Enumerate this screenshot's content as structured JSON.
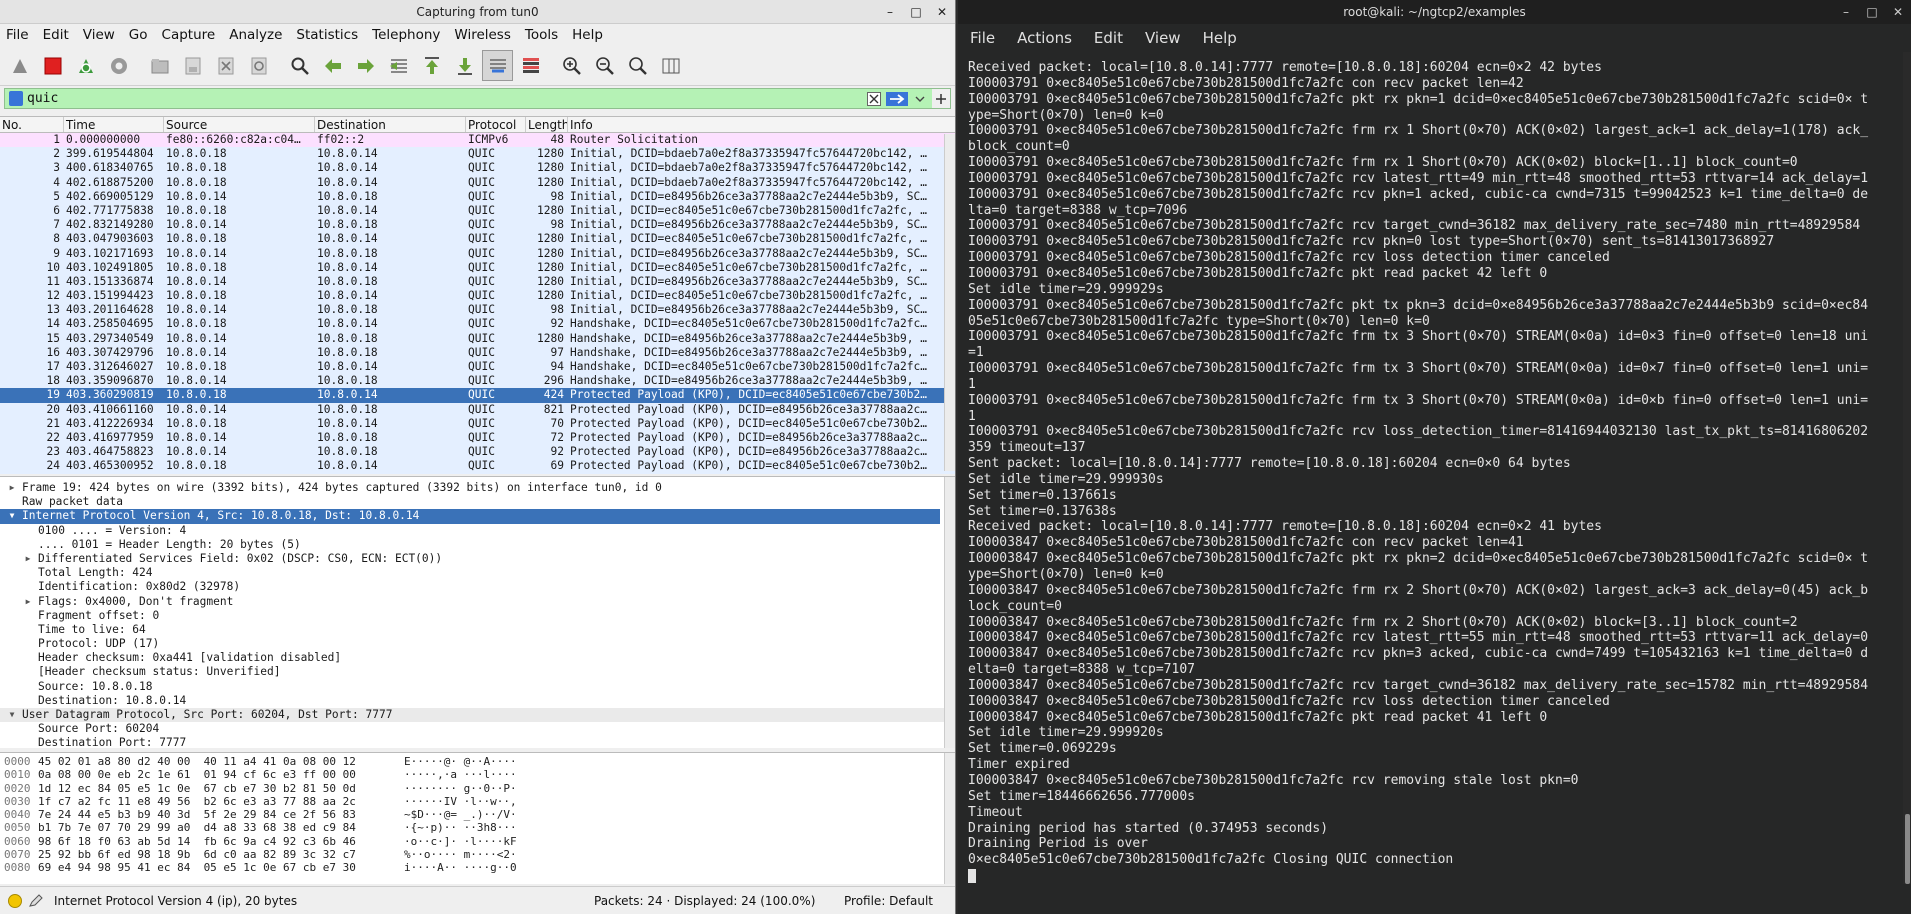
{
  "wireshark": {
    "window_title": "Capturing from tun0",
    "win_controls": [
      "–",
      "□",
      "✕"
    ],
    "menu": [
      "File",
      "Edit",
      "View",
      "Go",
      "Capture",
      "Analyze",
      "Statistics",
      "Telephony",
      "Wireless",
      "Tools",
      "Help"
    ],
    "filter_value": "quic",
    "columns": [
      "No.",
      "Time",
      "Source",
      "Destination",
      "Protocol",
      "Length",
      "Info"
    ],
    "packets": [
      {
        "no": "1",
        "time": "0.000000000",
        "src": "fe80::6260:c82a:c04…",
        "dst": "ff02::2",
        "proto": "ICMPv6",
        "len": "48",
        "info": "Router Solicitation"
      },
      {
        "no": "2",
        "time": "399.619544804",
        "src": "10.8.0.18",
        "dst": "10.8.0.14",
        "proto": "QUIC",
        "len": "1280",
        "info": "Initial, DCID=bdaeb7a0e2f8a37335947fc57644720bc142, …"
      },
      {
        "no": "3",
        "time": "400.618340765",
        "src": "10.8.0.18",
        "dst": "10.8.0.14",
        "proto": "QUIC",
        "len": "1280",
        "info": "Initial, DCID=bdaeb7a0e2f8a37335947fc57644720bc142, …"
      },
      {
        "no": "4",
        "time": "402.618875200",
        "src": "10.8.0.18",
        "dst": "10.8.0.14",
        "proto": "QUIC",
        "len": "1280",
        "info": "Initial, DCID=bdaeb7a0e2f8a37335947fc57644720bc142, …"
      },
      {
        "no": "5",
        "time": "402.669005129",
        "src": "10.8.0.14",
        "dst": "10.8.0.18",
        "proto": "QUIC",
        "len": "98",
        "info": "Initial, DCID=e84956b26ce3a37788aa2c7e2444e5b3b9, SC…"
      },
      {
        "no": "6",
        "time": "402.771775838",
        "src": "10.8.0.18",
        "dst": "10.8.0.14",
        "proto": "QUIC",
        "len": "1280",
        "info": "Initial, DCID=ec8405e51c0e67cbe730b281500d1fc7a2fc, …"
      },
      {
        "no": "7",
        "time": "402.832149280",
        "src": "10.8.0.14",
        "dst": "10.8.0.18",
        "proto": "QUIC",
        "len": "98",
        "info": "Initial, DCID=e84956b26ce3a37788aa2c7e2444e5b3b9, SC…"
      },
      {
        "no": "8",
        "time": "403.047903603",
        "src": "10.8.0.18",
        "dst": "10.8.0.14",
        "proto": "QUIC",
        "len": "1280",
        "info": "Initial, DCID=ec8405e51c0e67cbe730b281500d1fc7a2fc, …"
      },
      {
        "no": "9",
        "time": "403.102171693",
        "src": "10.8.0.14",
        "dst": "10.8.0.18",
        "proto": "QUIC",
        "len": "1280",
        "info": "Initial, DCID=e84956b26ce3a37788aa2c7e2444e5b3b9, SC…"
      },
      {
        "no": "10",
        "time": "403.102491805",
        "src": "10.8.0.18",
        "dst": "10.8.0.14",
        "proto": "QUIC",
        "len": "1280",
        "info": "Initial, DCID=ec8405e51c0e67cbe730b281500d1fc7a2fc, …"
      },
      {
        "no": "11",
        "time": "403.151336874",
        "src": "10.8.0.14",
        "dst": "10.8.0.18",
        "proto": "QUIC",
        "len": "1280",
        "info": "Initial, DCID=e84956b26ce3a37788aa2c7e2444e5b3b9, SC…"
      },
      {
        "no": "12",
        "time": "403.151994423",
        "src": "10.8.0.18",
        "dst": "10.8.0.14",
        "proto": "QUIC",
        "len": "1280",
        "info": "Initial, DCID=ec8405e51c0e67cbe730b281500d1fc7a2fc, …"
      },
      {
        "no": "13",
        "time": "403.201164628",
        "src": "10.8.0.14",
        "dst": "10.8.0.18",
        "proto": "QUIC",
        "len": "98",
        "info": "Initial, DCID=e84956b26ce3a37788aa2c7e2444e5b3b9, SC…"
      },
      {
        "no": "14",
        "time": "403.258504695",
        "src": "10.8.0.18",
        "dst": "10.8.0.14",
        "proto": "QUIC",
        "len": "92",
        "info": "Handshake, DCID=ec8405e51c0e67cbe730b281500d1fc7a2fc…"
      },
      {
        "no": "15",
        "time": "403.297340549",
        "src": "10.8.0.14",
        "dst": "10.8.0.18",
        "proto": "QUIC",
        "len": "1280",
        "info": "Handshake, DCID=e84956b26ce3a37788aa2c7e2444e5b3b9, …"
      },
      {
        "no": "16",
        "time": "403.307429796",
        "src": "10.8.0.14",
        "dst": "10.8.0.18",
        "proto": "QUIC",
        "len": "97",
        "info": "Handshake, DCID=e84956b26ce3a37788aa2c7e2444e5b3b9, …"
      },
      {
        "no": "17",
        "time": "403.312646027",
        "src": "10.8.0.18",
        "dst": "10.8.0.14",
        "proto": "QUIC",
        "len": "94",
        "info": "Handshake, DCID=ec8405e51c0e67cbe730b281500d1fc7a2fc…"
      },
      {
        "no": "18",
        "time": "403.359096870",
        "src": "10.8.0.14",
        "dst": "10.8.0.18",
        "proto": "QUIC",
        "len": "296",
        "info": "Handshake, DCID=e84956b26ce3a37788aa2c7e2444e5b3b9, …"
      },
      {
        "no": "19",
        "time": "403.360290819",
        "src": "10.8.0.18",
        "dst": "10.8.0.14",
        "proto": "QUIC",
        "len": "424",
        "info": "Protected Payload (KP0), DCID=ec8405e51c0e67cbe730b2…"
      },
      {
        "no": "20",
        "time": "403.410661160",
        "src": "10.8.0.14",
        "dst": "10.8.0.18",
        "proto": "QUIC",
        "len": "821",
        "info": "Protected Payload (KP0), DCID=e84956b26ce3a37788aa2c…"
      },
      {
        "no": "21",
        "time": "403.412226934",
        "src": "10.8.0.18",
        "dst": "10.8.0.14",
        "proto": "QUIC",
        "len": "70",
        "info": "Protected Payload (KP0), DCID=ec8405e51c0e67cbe730b2…"
      },
      {
        "no": "22",
        "time": "403.416977959",
        "src": "10.8.0.14",
        "dst": "10.8.0.18",
        "proto": "QUIC",
        "len": "72",
        "info": "Protected Payload (KP0), DCID=e84956b26ce3a37788aa2c…"
      },
      {
        "no": "23",
        "time": "403.464758823",
        "src": "10.8.0.14",
        "dst": "10.8.0.18",
        "proto": "QUIC",
        "len": "92",
        "info": "Protected Payload (KP0), DCID=e84956b26ce3a37788aa2c…"
      },
      {
        "no": "24",
        "time": "403.465300952",
        "src": "10.8.0.18",
        "dst": "10.8.0.14",
        "proto": "QUIC",
        "len": "69",
        "info": "Protected Payload (KP0), DCID=ec8405e51c0e67cbe730b2…"
      }
    ],
    "selected_packet": "19",
    "details": [
      {
        "indent": 0,
        "exp": "right",
        "text": "Frame 19: 424 bytes on wire (3392 bits), 424 bytes captured (3392 bits) on interface tun0, id 0"
      },
      {
        "indent": 0,
        "exp": "",
        "text": "Raw packet data"
      },
      {
        "indent": 0,
        "exp": "down",
        "text": "Internet Protocol Version 4, Src: 10.8.0.18, Dst: 10.8.0.14",
        "sel": true
      },
      {
        "indent": 1,
        "exp": "",
        "text": "0100 .... = Version: 4"
      },
      {
        "indent": 1,
        "exp": "",
        "text": ".... 0101 = Header Length: 20 bytes (5)"
      },
      {
        "indent": 1,
        "exp": "right",
        "text": "Differentiated Services Field: 0x02 (DSCP: CS0, ECN: ECT(0))"
      },
      {
        "indent": 1,
        "exp": "",
        "text": "Total Length: 424"
      },
      {
        "indent": 1,
        "exp": "",
        "text": "Identification: 0x80d2 (32978)"
      },
      {
        "indent": 1,
        "exp": "right",
        "text": "Flags: 0x4000, Don't fragment"
      },
      {
        "indent": 1,
        "exp": "",
        "text": "Fragment offset: 0"
      },
      {
        "indent": 1,
        "exp": "",
        "text": "Time to live: 64"
      },
      {
        "indent": 1,
        "exp": "",
        "text": "Protocol: UDP (17)"
      },
      {
        "indent": 1,
        "exp": "",
        "text": "Header checksum: 0xa441 [validation disabled]"
      },
      {
        "indent": 1,
        "exp": "",
        "text": "[Header checksum status: Unverified]"
      },
      {
        "indent": 1,
        "exp": "",
        "text": "Source: 10.8.0.18"
      },
      {
        "indent": 1,
        "exp": "",
        "text": "Destination: 10.8.0.14"
      },
      {
        "indent": 0,
        "exp": "down",
        "text": "User Datagram Protocol, Src Port: 60204, Dst Port: 7777",
        "hl": true
      },
      {
        "indent": 1,
        "exp": "",
        "text": "Source Port: 60204"
      },
      {
        "indent": 1,
        "exp": "",
        "text": "Destination Port: 7777"
      }
    ],
    "bytes": [
      {
        "off": "0000",
        "hex": "45 02 01 a8 80 d2 40 00  40 11 a4 41 0a 08 00 12",
        "asc": "E·····@· @··A····"
      },
      {
        "off": "0010",
        "hex": "0a 08 00 0e eb 2c 1e 61  01 94 cf 6c e3 ff 00 00",
        "asc": "·····,·a ···l····"
      },
      {
        "off": "0020",
        "hex": "1d 12 ec 84 05 e5 1c 0e  67 cb e7 30 b2 81 50 0d",
        "asc": "········ g··0··P·"
      },
      {
        "off": "0030",
        "hex": "1f c7 a2 fc 11 e8 49 56  b2 6c e3 a3 77 88 aa 2c",
        "asc": "······IV ·l··w··,"
      },
      {
        "off": "0040",
        "hex": "7e 24 44 e5 b3 b9 40 3d  5f 2e 29 84 ce 2f 56 83",
        "asc": "~$D···@= _.)··/V·"
      },
      {
        "off": "0050",
        "hex": "b1 7b 7e 07 70 29 99 a0  d4 a8 33 68 38 ed c9 84",
        "asc": "·{~·p)·· ··3h8···"
      },
      {
        "off": "0060",
        "hex": "98 6f 18 f0 63 ab 5d 14  fb 6c 9a c4 92 c3 6b 46",
        "asc": "·o··c·]· ·l····kF"
      },
      {
        "off": "0070",
        "hex": "25 92 bb 6f ed 98 18 9b  6d c0 aa 82 89 3c 32 c7",
        "asc": "%··o···· m····<2·"
      },
      {
        "off": "0080",
        "hex": "69 e4 94 98 95 41 ec 84  05 e5 1c 0e 67 cb e7 30",
        "asc": "i····A·· ····g··0"
      }
    ],
    "status": {
      "field": "Internet Protocol Version 4 (ip), 20 bytes",
      "packets": "Packets: 24 · Displayed: 24 (100.0%)",
      "profile": "Profile: Default"
    }
  },
  "terminal": {
    "window_title": "root@kali: ~/ngtcp2/examples",
    "menu": [
      "File",
      "Actions",
      "Edit",
      "View",
      "Help"
    ],
    "lines": [
      "Received packet: local=[10.8.0.14]:7777 remote=[10.8.0.18]:60204 ecn=0×2 42 bytes",
      "I00003791 0×ec8405e51c0e67cbe730b281500d1fc7a2fc con recv packet len=42",
      "I00003791 0×ec8405e51c0e67cbe730b281500d1fc7a2fc pkt rx pkn=1 dcid=0×ec8405e51c0e67cbe730b281500d1fc7a2fc scid=0× t",
      "ype=Short(0×70) len=0 k=0",
      "I00003791 0×ec8405e51c0e67cbe730b281500d1fc7a2fc frm rx 1 Short(0×70) ACK(0×02) largest_ack=1 ack_delay=1(178) ack_",
      "block_count=0",
      "I00003791 0×ec8405e51c0e67cbe730b281500d1fc7a2fc frm rx 1 Short(0×70) ACK(0×02) block=[1..1] block_count=0",
      "I00003791 0×ec8405e51c0e67cbe730b281500d1fc7a2fc rcv latest_rtt=49 min_rtt=48 smoothed_rtt=53 rttvar=14 ack_delay=1",
      "I00003791 0×ec8405e51c0e67cbe730b281500d1fc7a2fc rcv pkn=1 acked, cubic-ca cwnd=7315 t=99042523 k=1 time_delta=0 de",
      "lta=0 target=8388 w_tcp=7096",
      "I00003791 0×ec8405e51c0e67cbe730b281500d1fc7a2fc rcv target_cwnd=36182 max_delivery_rate_sec=7480 min_rtt=48929584",
      "I00003791 0×ec8405e51c0e67cbe730b281500d1fc7a2fc rcv pkn=0 lost type=Short(0×70) sent_ts=81413017368927",
      "I00003791 0×ec8405e51c0e67cbe730b281500d1fc7a2fc rcv loss detection timer canceled",
      "I00003791 0×ec8405e51c0e67cbe730b281500d1fc7a2fc pkt read packet 42 left 0",
      "Set idle timer=29.999929s",
      "I00003791 0×ec8405e51c0e67cbe730b281500d1fc7a2fc pkt tx pkn=3 dcid=0×e84956b26ce3a37788aa2c7e2444e5b3b9 scid=0×ec84",
      "05e51c0e67cbe730b281500d1fc7a2fc type=Short(0×70) len=0 k=0",
      "I00003791 0×ec8405e51c0e67cbe730b281500d1fc7a2fc frm tx 3 Short(0×70) STREAM(0×0a) id=0×3 fin=0 offset=0 len=18 uni",
      "=1",
      "I00003791 0×ec8405e51c0e67cbe730b281500d1fc7a2fc frm tx 3 Short(0×70) STREAM(0×0a) id=0×7 fin=0 offset=0 len=1 uni=",
      "1",
      "I00003791 0×ec8405e51c0e67cbe730b281500d1fc7a2fc frm tx 3 Short(0×70) STREAM(0×0a) id=0×b fin=0 offset=0 len=1 uni=",
      "1",
      "I00003791 0×ec8405e51c0e67cbe730b281500d1fc7a2fc rcv loss_detection_timer=81416944032130 last_tx_pkt_ts=81416806202",
      "359 timeout=137",
      "Sent packet: local=[10.8.0.14]:7777 remote=[10.8.0.18]:60204 ecn=0×0 64 bytes",
      "Set idle timer=29.999930s",
      "Set timer=0.137661s",
      "Set timer=0.137638s",
      "Received packet: local=[10.8.0.14]:7777 remote=[10.8.0.18]:60204 ecn=0×2 41 bytes",
      "I00003847 0×ec8405e51c0e67cbe730b281500d1fc7a2fc con recv packet len=41",
      "I00003847 0×ec8405e51c0e67cbe730b281500d1fc7a2fc pkt rx pkn=2 dcid=0×ec8405e51c0e67cbe730b281500d1fc7a2fc scid=0× t",
      "ype=Short(0×70) len=0 k=0",
      "I00003847 0×ec8405e51c0e67cbe730b281500d1fc7a2fc frm rx 2 Short(0×70) ACK(0×02) largest_ack=3 ack_delay=0(45) ack_b",
      "lock_count=0",
      "I00003847 0×ec8405e51c0e67cbe730b281500d1fc7a2fc frm rx 2 Short(0×70) ACK(0×02) block=[3..1] block_count=2",
      "I00003847 0×ec8405e51c0e67cbe730b281500d1fc7a2fc rcv latest_rtt=55 min_rtt=48 smoothed_rtt=53 rttvar=11 ack_delay=0",
      "I00003847 0×ec8405e51c0e67cbe730b281500d1fc7a2fc rcv pkn=3 acked, cubic-ca cwnd=7499 t=105432163 k=1 time_delta=0 d",
      "elta=0 target=8388 w_tcp=7107",
      "I00003847 0×ec8405e51c0e67cbe730b281500d1fc7a2fc rcv target_cwnd=36182 max_delivery_rate_sec=15782 min_rtt=48929584",
      "I00003847 0×ec8405e51c0e67cbe730b281500d1fc7a2fc rcv loss detection timer canceled",
      "I00003847 0×ec8405e51c0e67cbe730b281500d1fc7a2fc pkt read packet 41 left 0",
      "Set idle timer=29.999920s",
      "Set timer=0.069229s",
      "Timer expired",
      "I00003847 0×ec8405e51c0e67cbe730b281500d1fc7a2fc rcv removing stale lost pkn=0",
      "Set timer=18446662656.777000s",
      "Timeout",
      "Draining period has started (0.374953 seconds)",
      "Draining Period is over",
      "0×ec8405e51c0e67cbe730b281500d1fc7a2fc Closing QUIC connection"
    ]
  },
  "colors": {
    "selected_row": "#3a72b8",
    "quic_row": "#e4efff",
    "icmp_row": "#fce0ff",
    "filter_bg": "#b5f2b5",
    "terminal_bg": "#262727"
  }
}
